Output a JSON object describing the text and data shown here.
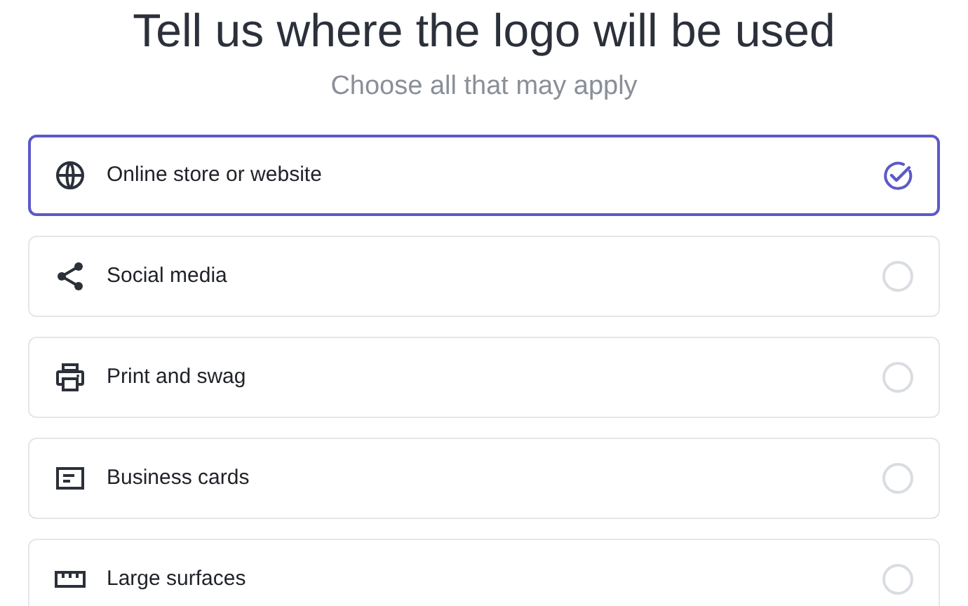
{
  "heading": "Tell us where the logo will be used",
  "subheading": "Choose all that may apply",
  "options": [
    {
      "kind": "globe",
      "label": "Online store or website",
      "selected": true
    },
    {
      "kind": "share",
      "label": "Social media",
      "selected": false
    },
    {
      "kind": "printer",
      "label": "Print and swag",
      "selected": false
    },
    {
      "kind": "card",
      "label": "Business cards",
      "selected": false
    },
    {
      "kind": "ruler",
      "label": "Large surfaces",
      "selected": false
    }
  ]
}
